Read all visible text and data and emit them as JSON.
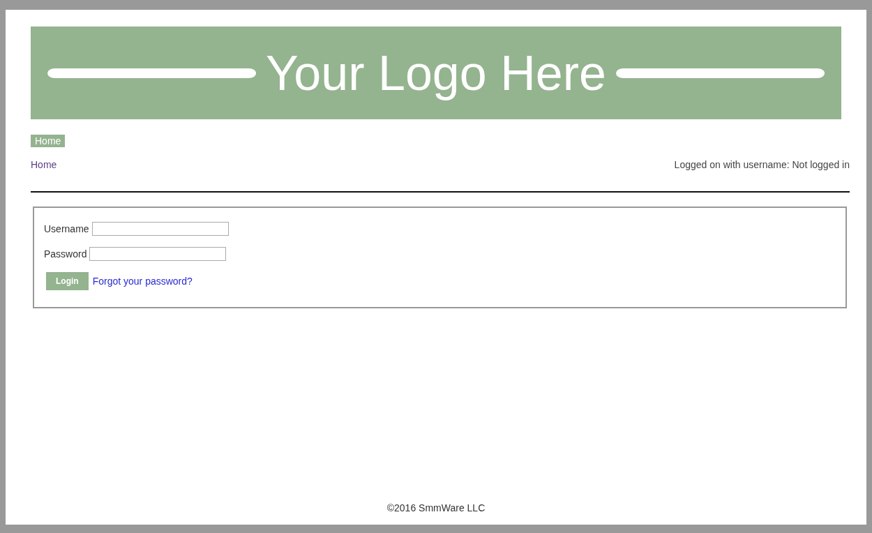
{
  "banner": {
    "logo_text": "Your Logo Here"
  },
  "nav": {
    "items": [
      {
        "label": "Home",
        "selected": true
      }
    ]
  },
  "breadcrumb": "Home",
  "login_status": "Logged on with username: Not logged in",
  "login_form": {
    "fields": [
      {
        "label": "Username"
      },
      {
        "label": "Password"
      }
    ],
    "button": "Login",
    "link": "Forgot your password?"
  },
  "footer": "©2016 SmmWare LLC"
}
